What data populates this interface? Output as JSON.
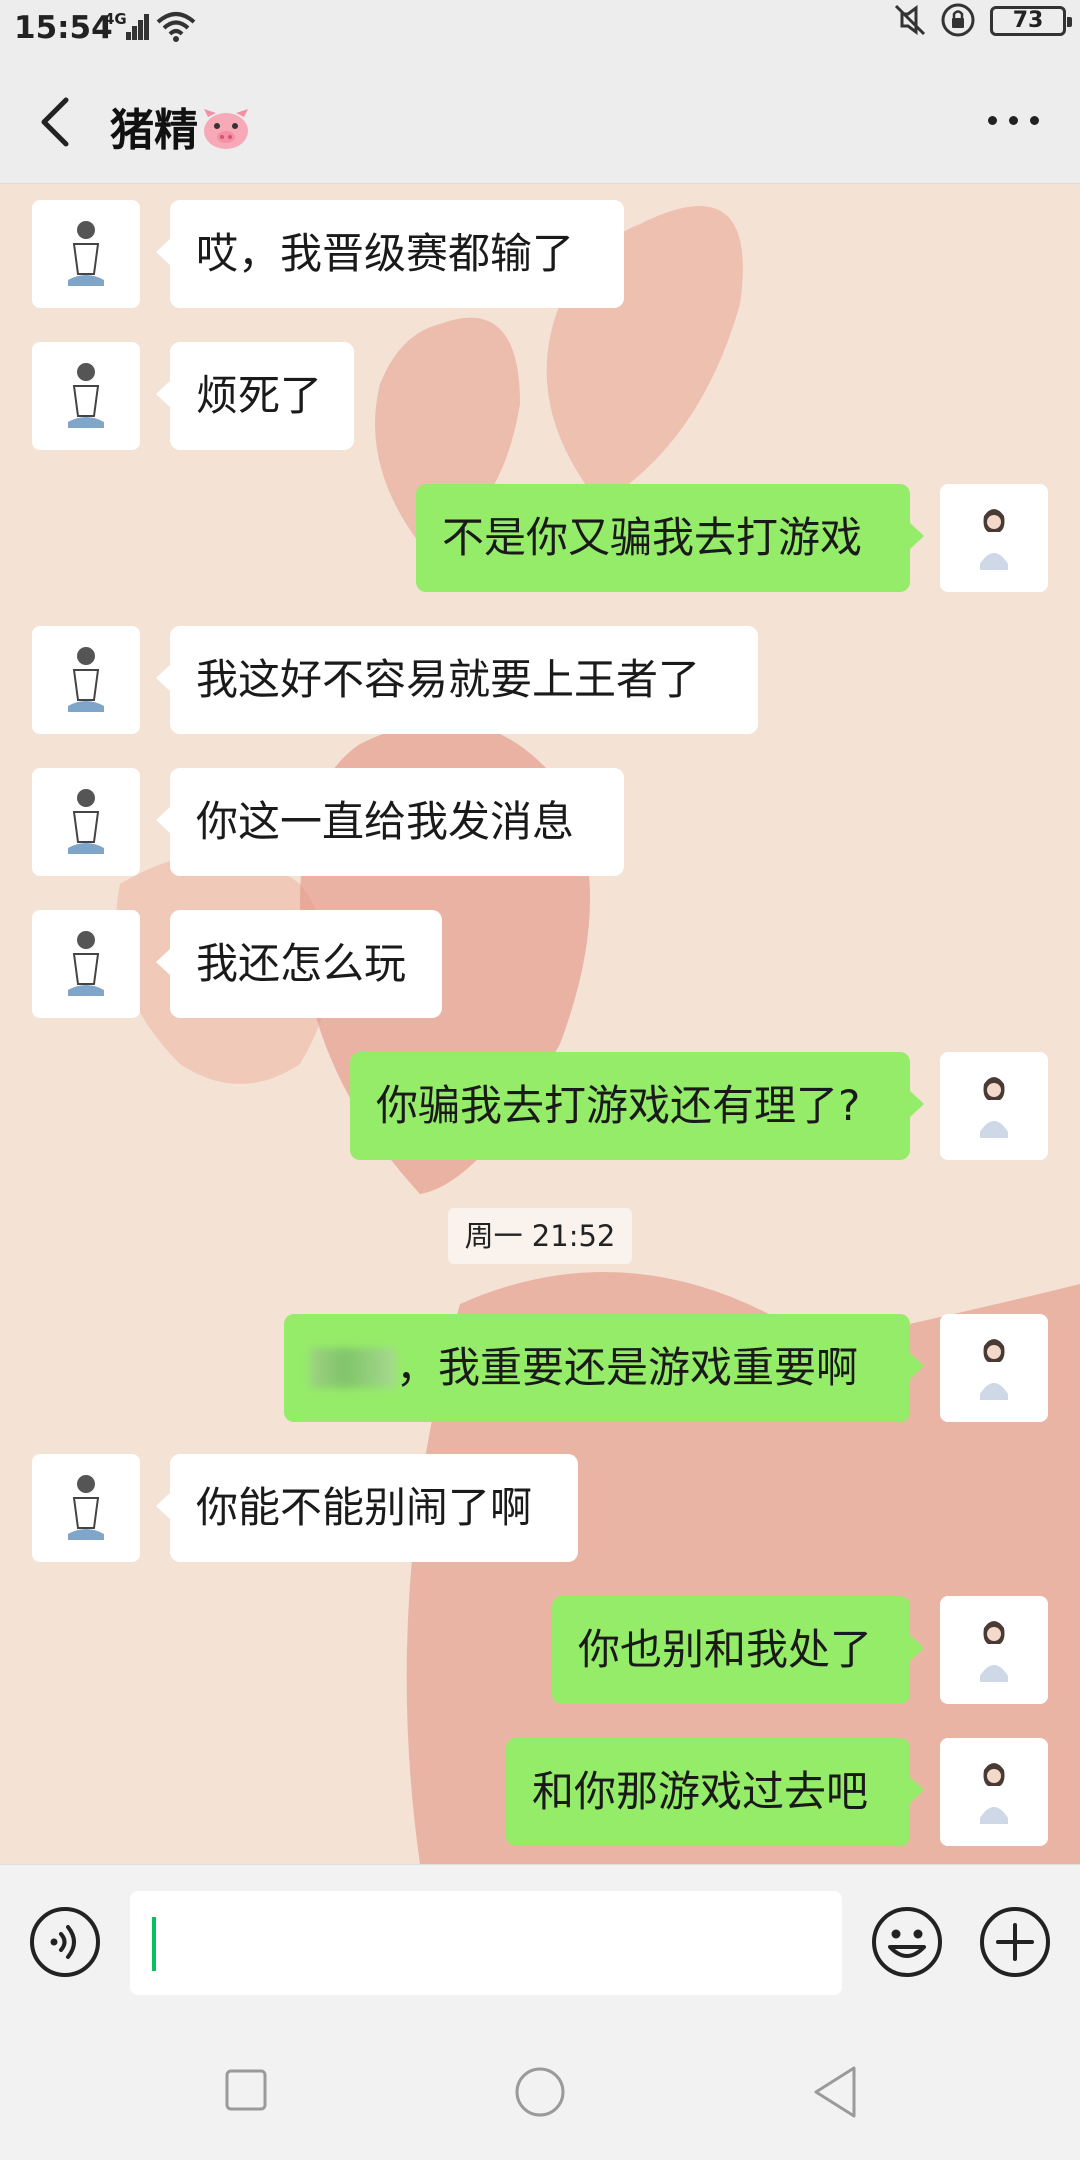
{
  "status_bar": {
    "time": "15:54",
    "network": "4G",
    "battery": "73"
  },
  "header": {
    "title": "猪精",
    "title_emoji": "pig-face-icon"
  },
  "colors": {
    "sent_bubble": "#95ec69",
    "received_bubble": "#ffffff",
    "chat_background": "#f4e2d5",
    "accent": "#07c160"
  },
  "messages": [
    {
      "side": "left",
      "text": "哎，我晋级赛都输了"
    },
    {
      "side": "left",
      "text": "烦死了"
    },
    {
      "side": "right",
      "text": "不是你又骗我去打游戏"
    },
    {
      "side": "left",
      "text": "我这好不容易就要上王者了"
    },
    {
      "side": "left",
      "text": "你这一直给我发消息"
    },
    {
      "side": "left",
      "text": "我还怎么玩"
    },
    {
      "side": "right",
      "text": "你骗我去打游戏还有理了?"
    },
    {
      "side": "right",
      "text": "，我重要还是游戏重要啊",
      "redacted_prefix": true
    },
    {
      "side": "left",
      "text": "你能不能别闹了啊"
    },
    {
      "side": "right",
      "text": "你也别和我处了"
    },
    {
      "side": "right",
      "text": "和你那游戏过去吧"
    }
  ],
  "timestamp": "周一 21:52",
  "input": {
    "value": ""
  }
}
